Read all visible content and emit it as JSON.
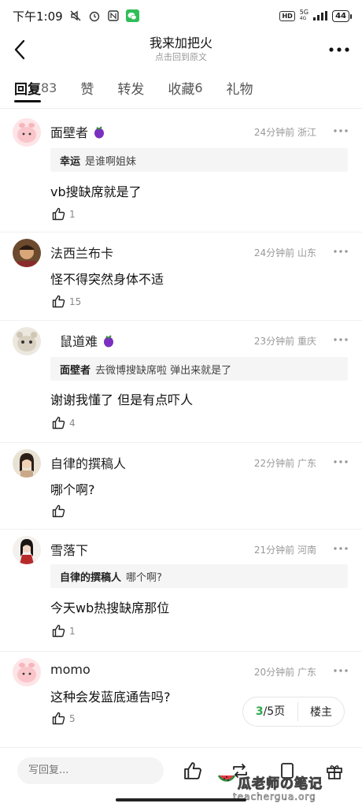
{
  "status": {
    "time": "下午1:09",
    "hd": "HD",
    "signal": "5G",
    "signal_sub": "4G",
    "battery": "44"
  },
  "nav": {
    "title": "我来加把火",
    "subtitle": "点击回到原文"
  },
  "tabs": [
    {
      "label": "回复",
      "count": "83",
      "active": true
    },
    {
      "label": "赞",
      "count": ""
    },
    {
      "label": "转发",
      "count": ""
    },
    {
      "label": "收藏",
      "count": "6"
    },
    {
      "label": "礼物",
      "count": ""
    }
  ],
  "comments": [
    {
      "name": "面壁者",
      "badge": "eggplant",
      "meta": "24分钟前 浙江",
      "quote_user": "幸运",
      "quote_text": "是谁啊姐妹",
      "text": "vb搜缺席就是了",
      "likes": "1"
    },
    {
      "name": "法西兰布卡",
      "meta": "24分钟前 山东",
      "text": "怪不得突然身体不适",
      "likes": "15"
    },
    {
      "name": "鼠道难",
      "badge": "eggplant",
      "meta": "23分钟前 重庆",
      "quote_user": "面壁者",
      "quote_text": "去微博搜缺席啦 弹出来就是了",
      "text": "谢谢我懂了  但是有点吓人",
      "likes": "4"
    },
    {
      "name": "自律的撰稿人",
      "meta": "22分钟前 广东",
      "text": "哪个啊?",
      "likes": ""
    },
    {
      "name": "雪落下",
      "meta": "21分钟前 河南",
      "quote_user": "自律的撰稿人",
      "quote_text": "哪个啊?",
      "text": "今天wb热搜缺席那位",
      "likes": "1"
    },
    {
      "name": "momo",
      "meta": "20分钟前 广东",
      "text": "这种会发蓝底通告吗?",
      "likes": "5"
    }
  ],
  "pager": {
    "current": "3",
    "rest": "/5页",
    "op": "楼主"
  },
  "bottom": {
    "reply_placeholder": "写回复..."
  },
  "watermark": {
    "line1": "瓜老师の笔记",
    "line2": "teachergua.org"
  },
  "colors": {
    "accent_green": "#2aa84a",
    "eggplant": "#7b2fbf"
  }
}
